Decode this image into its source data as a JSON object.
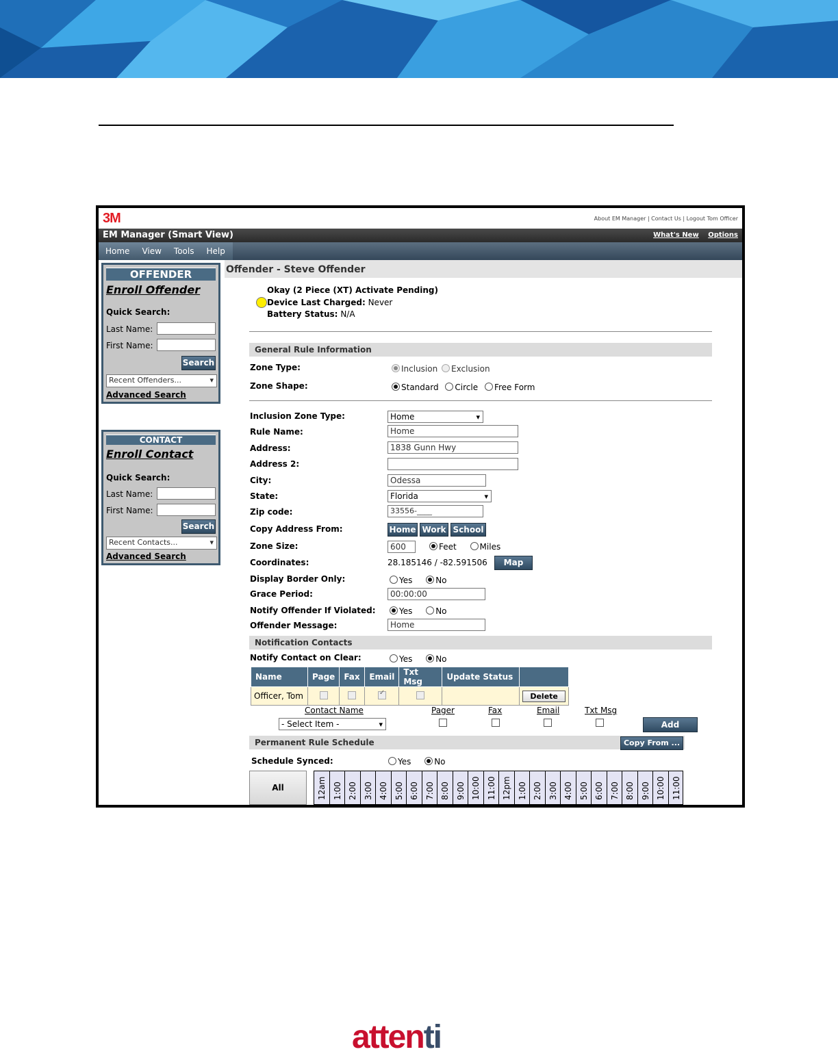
{
  "top_links": "About EM Manager | Contact Us | Logout Tom Officer",
  "brand": "3M",
  "app_title": "EM Manager (Smart View)",
  "title_links": {
    "whats_new": "What's New",
    "options": "Options"
  },
  "menu": [
    "Home",
    "View",
    "Tools",
    "Help"
  ],
  "offender_panel": {
    "header": "OFFENDER",
    "enroll": "Enroll Offender",
    "quick_search": "Quick Search:",
    "last_name": "Last Name:",
    "first_name": "First Name:",
    "search": "Search",
    "recent": "Recent Offenders...",
    "advanced": "Advanced Search"
  },
  "contact_panel": {
    "header": "CONTACT",
    "enroll": "Enroll Contact",
    "quick_search": "Quick Search:",
    "last_name": "Last Name:",
    "first_name": "First Name:",
    "search": "Search",
    "recent": "Recent Contacts...",
    "advanced": "Advanced Search"
  },
  "content_title": "Offender - Steve Offender",
  "status": {
    "line1": "Okay (2 Piece (XT) Activate Pending)",
    "charged_label": "Device Last Charged:",
    "charged_value": "Never",
    "battery_label": "Battery Status:",
    "battery_value": "N/A"
  },
  "general": {
    "section": "General Rule Information",
    "zone_type_label": "Zone Type:",
    "zone_type_options": [
      "Inclusion",
      "Exclusion"
    ],
    "zone_shape_label": "Zone Shape:",
    "zone_shape_options": [
      "Standard",
      "Circle",
      "Free Form"
    ]
  },
  "form": {
    "inclusion_zone_type_label": "Inclusion Zone Type:",
    "inclusion_zone_type_value": "Home",
    "rule_name_label": "Rule Name:",
    "rule_name_value": "Home",
    "address_label": "Address:",
    "address_value": "1838 Gunn Hwy",
    "address2_label": "Address 2:",
    "address2_value": "",
    "city_label": "City:",
    "city_value": "Odessa",
    "state_label": "State:",
    "state_value": "Florida",
    "zip_label": "Zip code:",
    "zip_value": "33556-____",
    "copy_from_label": "Copy Address From:",
    "copy_buttons": [
      "Home",
      "Work",
      "School"
    ],
    "zone_size_label": "Zone Size:",
    "zone_size_value": "600",
    "zone_size_units": [
      "Feet",
      "Miles"
    ],
    "coords_label": "Coordinates:",
    "coords_value": "28.185146 / -82.591506",
    "map_button": "Map",
    "display_border_label": "Display Border Only:",
    "grace_label": "Grace Period:",
    "grace_value": "00:00:00",
    "notify_violated_label": "Notify Offender If Violated:",
    "message_label": "Offender Message:",
    "message_value": "Home",
    "yes": "Yes",
    "no": "No"
  },
  "notification": {
    "section": "Notification Contacts",
    "notify_clear_label": "Notify Contact on Clear:",
    "columns": [
      "Name",
      "Page",
      "Fax",
      "Email",
      "Txt Msg",
      "Update Status",
      ""
    ],
    "row": {
      "name": "Officer, Tom",
      "delete": "Delete"
    },
    "add_labels": {
      "contact_name": "Contact Name",
      "pager": "Pager",
      "fax": "Fax",
      "email": "Email",
      "txt": "Txt Msg"
    },
    "select_item": "- Select Item -",
    "add_button": "Add"
  },
  "schedule": {
    "section": "Permanent Rule Schedule",
    "copy_from": "Copy From ...",
    "synced_label": "Schedule Synced:",
    "all_button": "All",
    "hours": [
      "12am",
      "1:00",
      "2:00",
      "3:00",
      "4:00",
      "5:00",
      "6:00",
      "7:00",
      "8:00",
      "9:00",
      "10:00",
      "11:00",
      "12pm",
      "1:00",
      "2:00",
      "3:00",
      "4:00",
      "5:00",
      "6:00",
      "7:00",
      "8:00",
      "9:00",
      "10:00",
      "11:00"
    ]
  },
  "footer_brand": {
    "part1": "atten",
    "part2": "ti"
  }
}
